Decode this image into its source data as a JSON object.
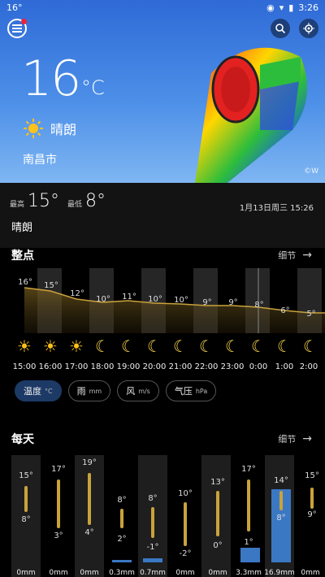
{
  "status": {
    "left": "16°",
    "time": "3:26"
  },
  "hero": {
    "temperature": "16",
    "unit": "°C",
    "condition": "晴朗",
    "city": "南昌市",
    "credit": "©W"
  },
  "info": {
    "high_label": "最高",
    "high": "15°",
    "low_label": "最低",
    "low": "8°",
    "date": "1月13日周三  15:26",
    "condition": "晴朗"
  },
  "hourly_section": {
    "title": "整点",
    "more": "细节"
  },
  "hourly": {
    "temps": [
      "16°",
      "15°",
      "12°",
      "10°",
      "11°",
      "10°",
      "10°",
      "9°",
      "9°",
      "8°",
      "6°",
      "5°"
    ],
    "times": [
      "15:00",
      "16:00",
      "17:00",
      "18:00",
      "19:00",
      "20:00",
      "21:00",
      "22:00",
      "23:00",
      "0:00",
      "1:00",
      "2:00"
    ],
    "icons": [
      "sun-icon",
      "sun-icon",
      "sun-icon",
      "moon-icon",
      "moon-icon",
      "moon-icon",
      "moon-icon",
      "moon-icon",
      "moon-icon",
      "moon-icon",
      "moon-icon",
      "moon-icon"
    ]
  },
  "chips": [
    {
      "label": "温度",
      "unit": "°C"
    },
    {
      "label": "雨",
      "unit": "mm"
    },
    {
      "label": "风",
      "unit": "m/s"
    },
    {
      "label": "气压",
      "unit": "hPa"
    }
  ],
  "daily_section": {
    "title": "每天",
    "more": "细节"
  },
  "daily": {
    "highs": [
      "15°",
      "17°",
      "19°",
      "8°",
      "8°",
      "10°",
      "13°",
      "17°",
      "14°",
      "15°"
    ],
    "lows": [
      "8°",
      "3°",
      "4°",
      "2°",
      "-1°",
      "-2°",
      "0°",
      "1°",
      "8°",
      "9°"
    ],
    "rain": [
      "0mm",
      "0mm",
      "0mm",
      "0.3mm",
      "0.7mm",
      "0mm",
      "0mm",
      "3.3mm",
      "16.9mm",
      "0mm"
    ]
  },
  "colors": {
    "accent": "#c9a23b",
    "chip_active": "#1d3a66",
    "rain": "#3b78c4"
  }
}
